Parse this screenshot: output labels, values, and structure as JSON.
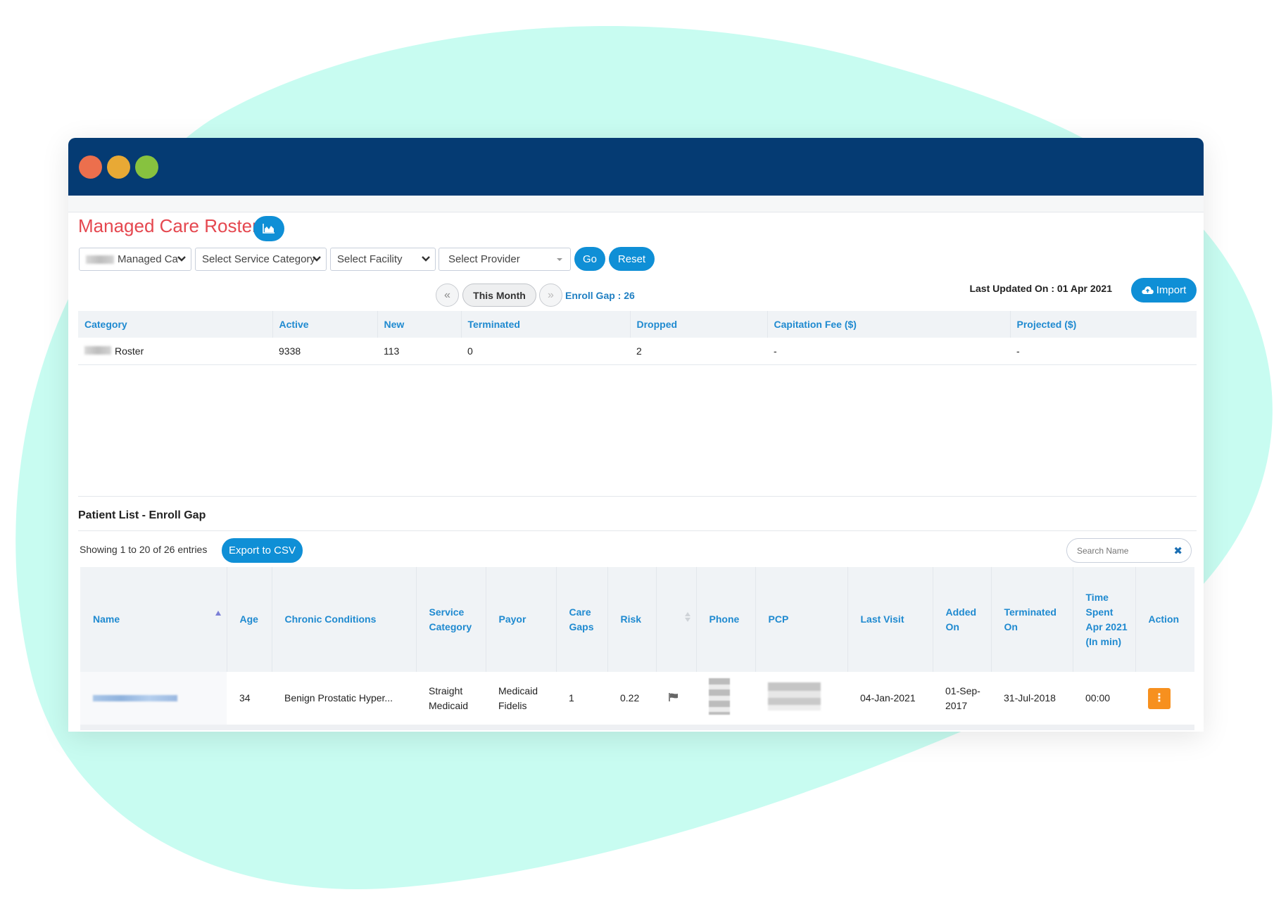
{
  "window": {
    "traffic_lights": [
      "close",
      "minimize",
      "maximize"
    ]
  },
  "page": {
    "title": "Managed Care Roster",
    "chart_button_icon": "area-chart-icon"
  },
  "filters": {
    "plan_select": {
      "value": "Managed Ca"
    },
    "service_category_select": {
      "value": "Select Service Category"
    },
    "facility_select": {
      "value": "Select Facility"
    },
    "provider_select": {
      "value": "Select Provider"
    },
    "go_label": "Go",
    "reset_label": "Reset"
  },
  "period_nav": {
    "prev_icon": "«",
    "current_label": "This Month",
    "next_icon": "»",
    "enroll_gap": "Enroll Gap : 26"
  },
  "status": {
    "last_updated": "Last Updated On : 01 Apr 2021",
    "import_label": "Import"
  },
  "summary_table": {
    "headers": [
      "Category",
      "Active",
      "New",
      "Terminated",
      "Dropped",
      "Capitation Fee ($)",
      "Projected ($)"
    ],
    "rows": [
      {
        "category": "Roster",
        "active": "9338",
        "new": "113",
        "terminated": "0",
        "dropped": "2",
        "capitation_fee": "-",
        "projected": "-"
      }
    ]
  },
  "patient_list": {
    "title": "Patient List - Enroll Gap",
    "showing": "Showing 1 to 20 of 26 entries",
    "export_label": "Export to CSV",
    "search_placeholder": "Search Name",
    "headers": [
      "Name",
      "Age",
      "Chronic Conditions",
      "Service Category",
      "Payor",
      "Care Gaps",
      "Risk",
      "",
      "Phone",
      "PCP",
      "Last Visit",
      "Added On",
      "Terminated On",
      "Time Spent Apr 2021 (In min)",
      "Action"
    ],
    "rows": [
      {
        "age": "34",
        "chronic_conditions": "Benign Prostatic Hyper...",
        "service_category": "Straight Medicaid",
        "payor": "Medicaid Fidelis",
        "care_gaps": "1",
        "risk": "0.22",
        "flag_icon": "flag-icon",
        "last_visit": "04-Jan-2021",
        "added_on": "01-Sep-2017",
        "terminated_on": "31-Jul-2018",
        "time_spent": "00:00",
        "action_icon": "⋮"
      }
    ]
  },
  "colors": {
    "titlebar": "#053b73",
    "accent": "#0f8fd6",
    "title_red": "#e5474f",
    "header_blue": "#1f8ad0",
    "action_orange": "#f7901e",
    "blob": "#c8fcf1"
  }
}
